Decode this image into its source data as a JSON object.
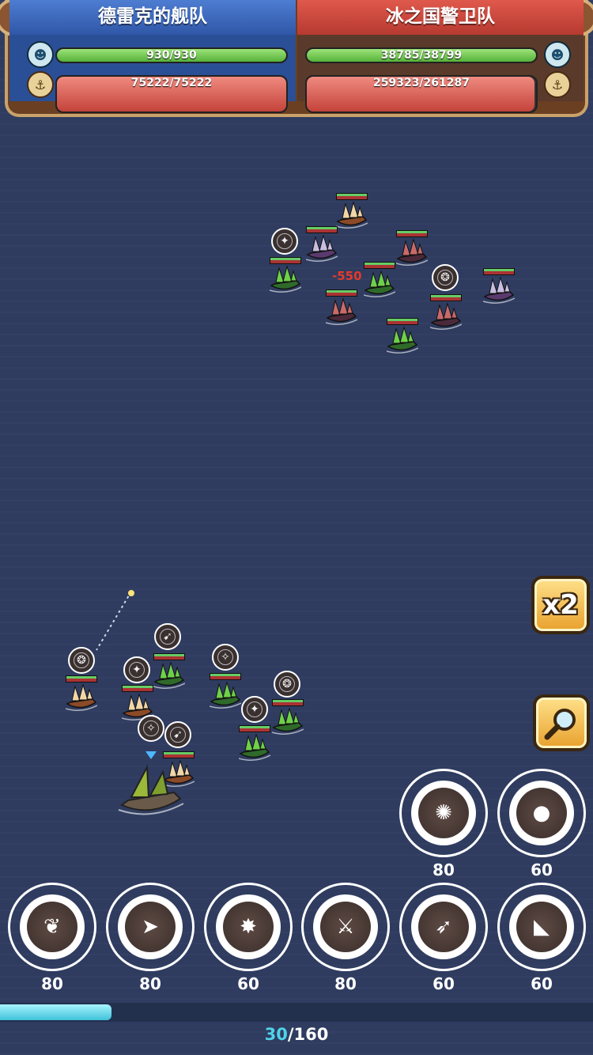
{
  "teams": {
    "left": {
      "name": "德雷克的舰队",
      "crew": {
        "text": "930/930",
        "ratio": 1.0
      },
      "ships": {
        "text": "75222/75222",
        "ratio": 1.0
      }
    },
    "right": {
      "name": "冰之国警卫队",
      "crew": {
        "text": "38785/38799",
        "ratio": 0.9996
      },
      "ships": {
        "text": "259323/261287",
        "ratio": 0.992
      }
    }
  },
  "icons": {
    "crew": "pirate-head-icon",
    "ships": "ship-wheel-icon"
  },
  "battle": {
    "damage_text": "-550"
  },
  "controls": {
    "speed_label": "x2",
    "zoom_icon": "magnifier-icon"
  },
  "skills_top": [
    {
      "icon": "orbit-blast-icon",
      "cost": "80"
    },
    {
      "icon": "cannonball-icon",
      "cost": "60"
    }
  ],
  "skills_bottom": [
    {
      "icon": "winged-emblem-icon",
      "cost": "80"
    },
    {
      "icon": "charging-beast-icon",
      "cost": "80"
    },
    {
      "icon": "spiked-burst-icon",
      "cost": "60"
    },
    {
      "icon": "crossed-swords-icon",
      "cost": "80"
    },
    {
      "icon": "dash-strike-icon",
      "cost": "60"
    },
    {
      "icon": "shark-fin-icon",
      "cost": "60"
    }
  ],
  "energy": {
    "current": "30",
    "separator": "/",
    "max": "160",
    "ratio": 0.1875
  },
  "colors": {
    "sea": "#2f3c60",
    "allied_team": "#3a66bd",
    "enemy_team": "#cc4a3e",
    "hp_green": "#6cc94a",
    "hp_red": "#d9534a",
    "energy_cyan": "#4fd3e8"
  }
}
